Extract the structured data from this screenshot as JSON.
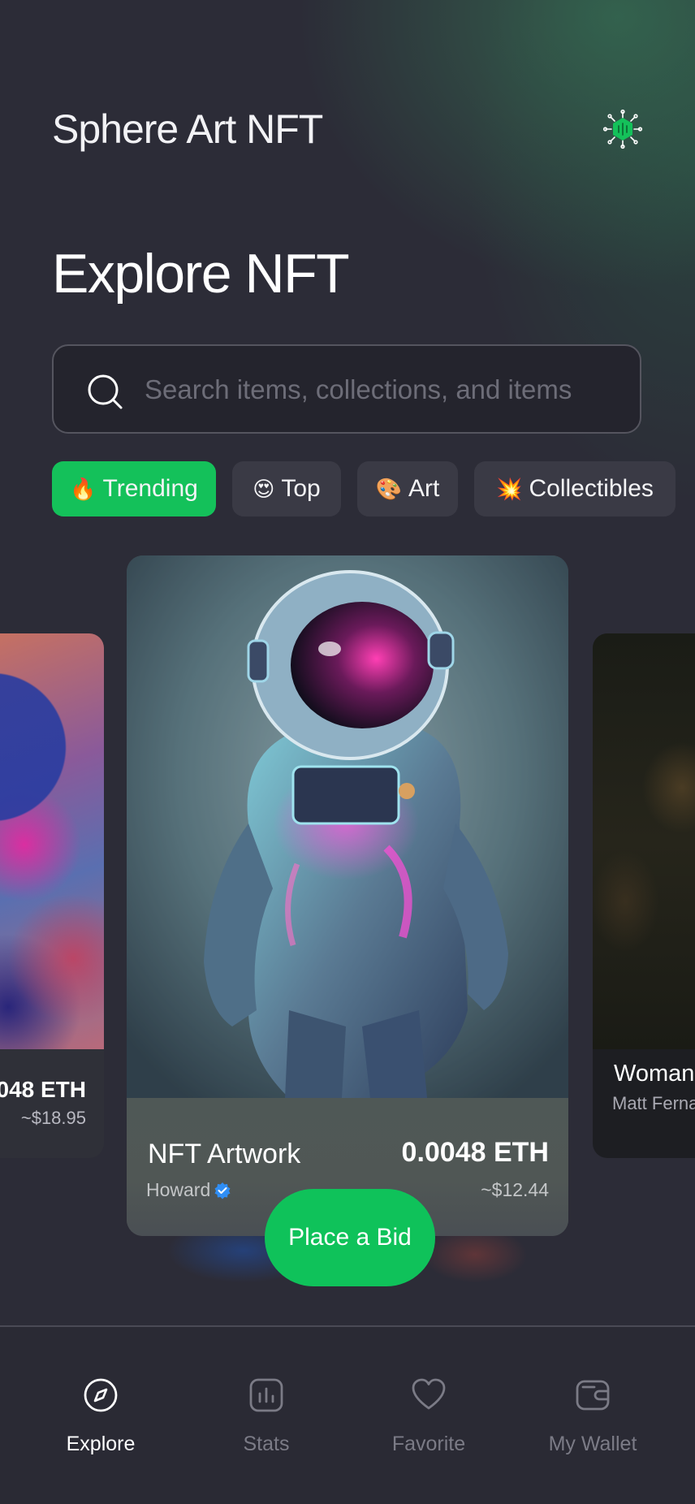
{
  "header": {
    "app_title": "Sphere Art NFT",
    "logo_icon": "nft-chip-logo-icon"
  },
  "page_title": "Explore NFT",
  "search": {
    "placeholder": "Search items, collections, and items",
    "value": "",
    "icon": "search-icon"
  },
  "categories": [
    {
      "emoji": "🔥",
      "label": "Trending",
      "active": true
    },
    {
      "emoji": "😍",
      "label": "Top",
      "active": false
    },
    {
      "emoji": "🎨",
      "label": "Art",
      "active": false
    },
    {
      "emoji": "💥",
      "label": "Collectibles",
      "active": false
    }
  ],
  "cards": {
    "left": {
      "eth": "048 ETH",
      "usd": "~$18.95"
    },
    "main": {
      "name": "NFT Artwork",
      "artist": "Howard",
      "eth": "0.0048 ETH",
      "usd": "~$12.44",
      "verified_icon": "verified-badge-icon"
    },
    "right": {
      "name": "Woman",
      "artist": "Matt Ferna"
    }
  },
  "bid_button": "Place a Bid",
  "bottom_nav": [
    {
      "label": "Explore",
      "icon": "compass-icon",
      "active": true
    },
    {
      "label": "Stats",
      "icon": "bar-chart-icon",
      "active": false
    },
    {
      "label": "Favorite",
      "icon": "heart-icon",
      "active": false
    },
    {
      "label": "My Wallet",
      "icon": "wallet-icon",
      "active": false
    }
  ],
  "colors": {
    "background": "#2c2c37",
    "accent_green": "#14c15a",
    "chip_bg": "#3a3a45",
    "inactive_nav": "#7b7b86"
  }
}
